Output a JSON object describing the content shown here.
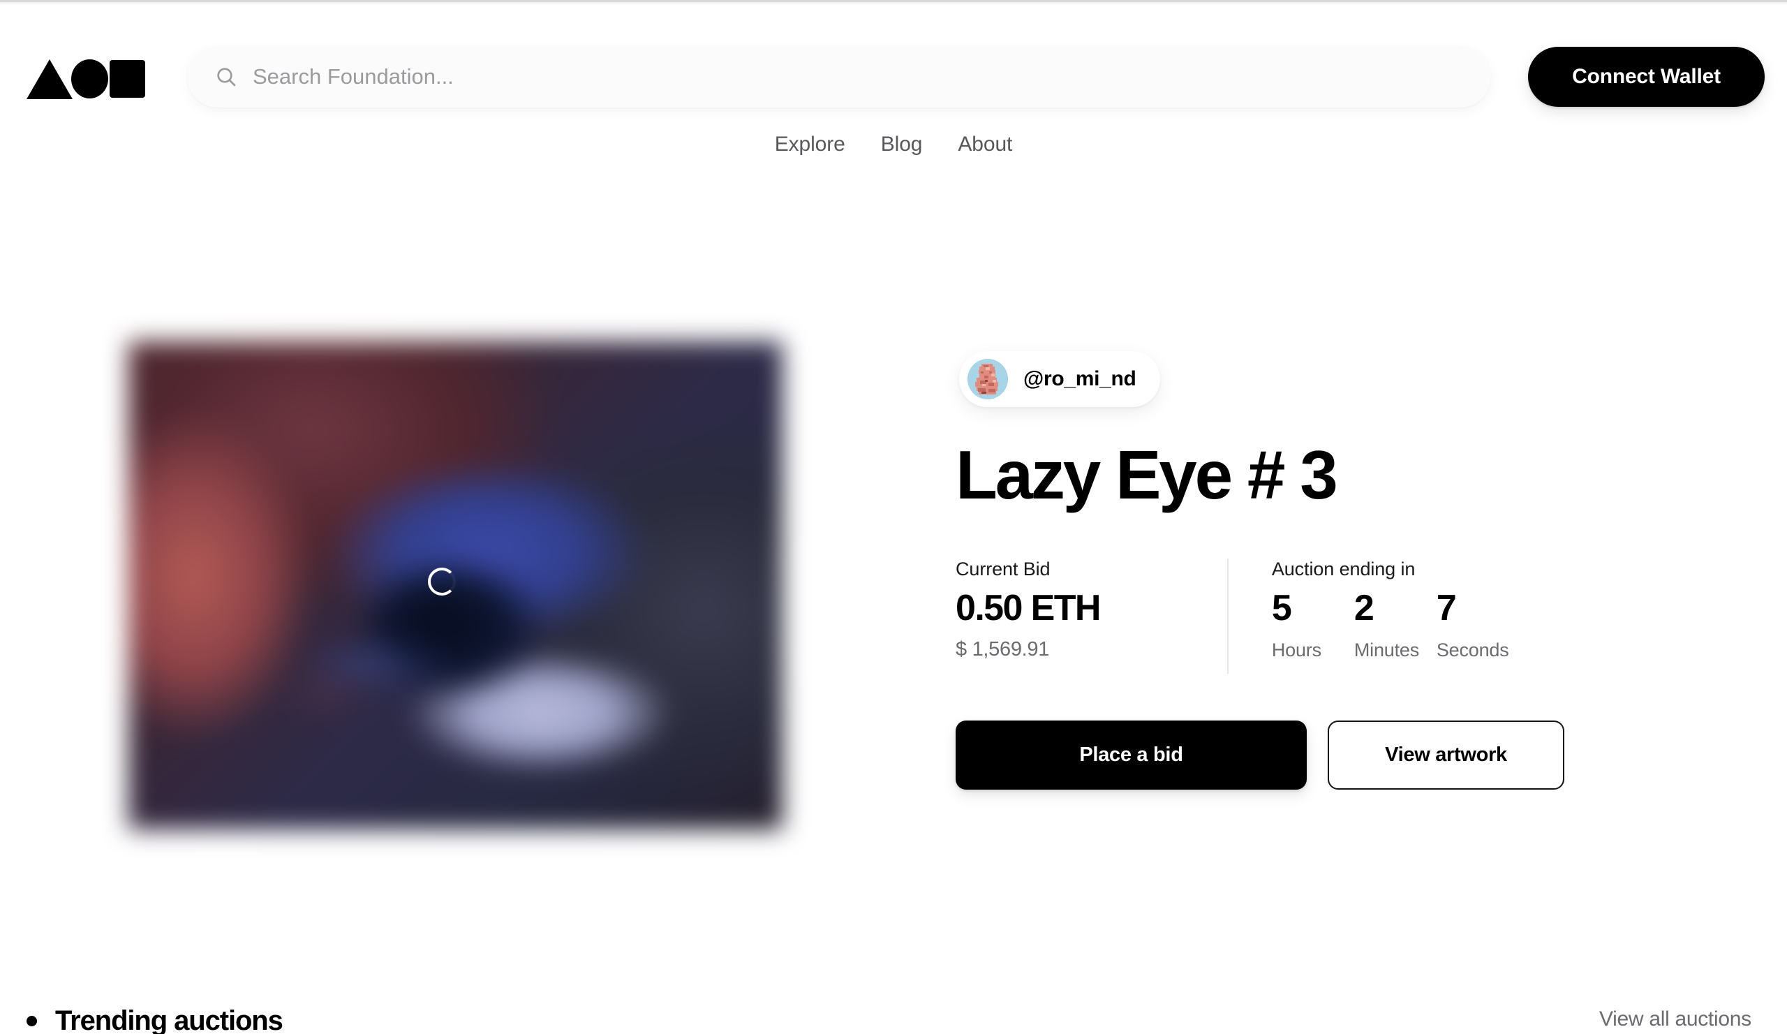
{
  "brand": {
    "logo_name": "foundation-logo",
    "logo_shapes": [
      "triangle",
      "circle",
      "square"
    ],
    "accent_black": "#000000",
    "muted_text": "#6b6b70",
    "divider": "#e6e6e8"
  },
  "header": {
    "search": {
      "placeholder": "Search Foundation...",
      "value": "",
      "icon": "search-icon"
    },
    "connect_wallet_label": "Connect Wallet"
  },
  "nav": {
    "items": [
      {
        "label": "Explore"
      },
      {
        "label": "Blog"
      },
      {
        "label": "About"
      }
    ]
  },
  "hero": {
    "artwork": {
      "alt": "Lazy Eye # 3 artwork preview",
      "state": "loading",
      "spinner": "loading-spinner"
    },
    "artist": {
      "handle": "@ro_mi_nd",
      "avatar_name": "artist-avatar"
    },
    "title": "Lazy Eye # 3",
    "current_bid": {
      "label": "Current Bid",
      "eth": "0.50 ETH",
      "usd": "$ 1,569.91"
    },
    "auction": {
      "label": "Auction ending in",
      "units": [
        {
          "value": "5",
          "label": "Hours"
        },
        {
          "value": "2",
          "label": "Minutes"
        },
        {
          "value": "7",
          "label": "Seconds"
        }
      ]
    },
    "actions": {
      "place_bid_label": "Place a bid",
      "view_artwork_label": "View artwork"
    }
  },
  "trending": {
    "title": "Trending auctions",
    "view_all_label": "View all auctions"
  }
}
